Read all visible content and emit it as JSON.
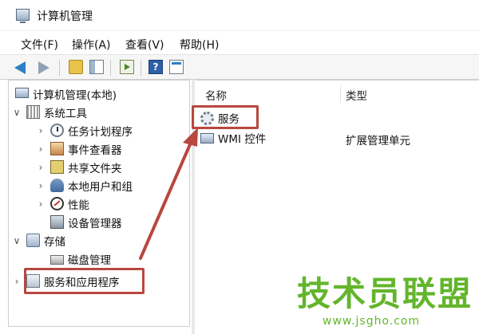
{
  "window": {
    "title": "计算机管理"
  },
  "menu": [
    {
      "label": "文件(F)"
    },
    {
      "label": "操作(A)"
    },
    {
      "label": "查看(V)"
    },
    {
      "label": "帮助(H)"
    }
  ],
  "toolbar": {
    "buttons": [
      "back-arrow-icon",
      "forward-arrow-icon",
      "up-folder-icon",
      "show-hide-tree-icon",
      "export-list-icon",
      "help-icon",
      "properties-icon"
    ],
    "help_glyph": "?"
  },
  "tree": {
    "root": "计算机管理(本地)",
    "items": [
      {
        "label": "系统工具",
        "chevron": "∨",
        "icon": "tools-icon"
      },
      {
        "label": "任务计划程序",
        "chevron": "›",
        "icon": "clock-icon"
      },
      {
        "label": "事件查看器",
        "chevron": "›",
        "icon": "event-viewer-icon"
      },
      {
        "label": "共享文件夹",
        "chevron": "›",
        "icon": "shared-folder-icon"
      },
      {
        "label": "本地用户和组",
        "chevron": "›",
        "icon": "users-icon"
      },
      {
        "label": "性能",
        "chevron": "›",
        "icon": "performance-icon"
      },
      {
        "label": "设备管理器",
        "chevron": "",
        "icon": "device-manager-icon"
      },
      {
        "label": "存储",
        "chevron": "∨",
        "icon": "storage-icon"
      },
      {
        "label": "磁盘管理",
        "chevron": "",
        "icon": "disk-icon"
      },
      {
        "label": "服务和应用程序",
        "chevron": "›",
        "icon": "services-apps-icon"
      }
    ]
  },
  "list": {
    "columns": [
      "名称",
      "类型"
    ],
    "rows": [
      {
        "name": "服务",
        "type": "",
        "icon": "gear-icon"
      },
      {
        "name": "WMI 控件",
        "type": "扩展管理单元",
        "icon": "wmi-icon"
      }
    ]
  },
  "annotation": {
    "color": "#b8473e"
  },
  "watermark": {
    "text": "技术员联盟",
    "url": "www.jsgho.com",
    "color": "#63b52c"
  }
}
